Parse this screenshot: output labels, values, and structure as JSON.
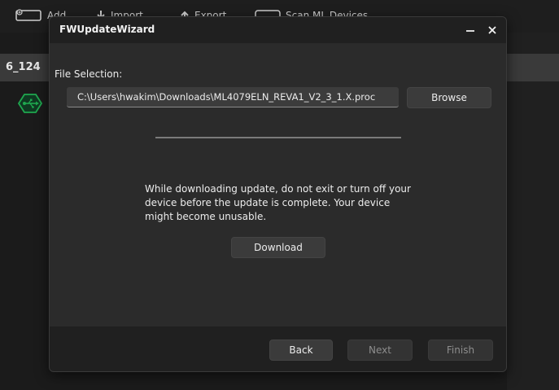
{
  "toolbar": {
    "add_label": "Add",
    "import_label": "Import",
    "export_label": "Export",
    "scan_label": "Scan ML Devices"
  },
  "device_list": {
    "row_label": "6_124"
  },
  "dialog": {
    "title": "FWUpdateWizard",
    "minimize_label": "–",
    "close_label": "×",
    "file_selection_label": "File Selection:",
    "file_path": "C:\\Users\\hwakim\\Downloads\\ML4079ELN_REVA1_V2_3_1.X.proc",
    "browse_label": "Browse",
    "progress_fraction": 0,
    "warning_text": "While downloading update, do not exit or turn off your device before the update is complete. Your device might become unusable.",
    "download_label": "Download",
    "back_label": "Back",
    "next_label": "Next",
    "finish_label": "Finish"
  },
  "colors": {
    "usb_badge": "#1fa84f",
    "dialog_bg": "#2b2b2b",
    "titlebar_bg": "#202020"
  }
}
